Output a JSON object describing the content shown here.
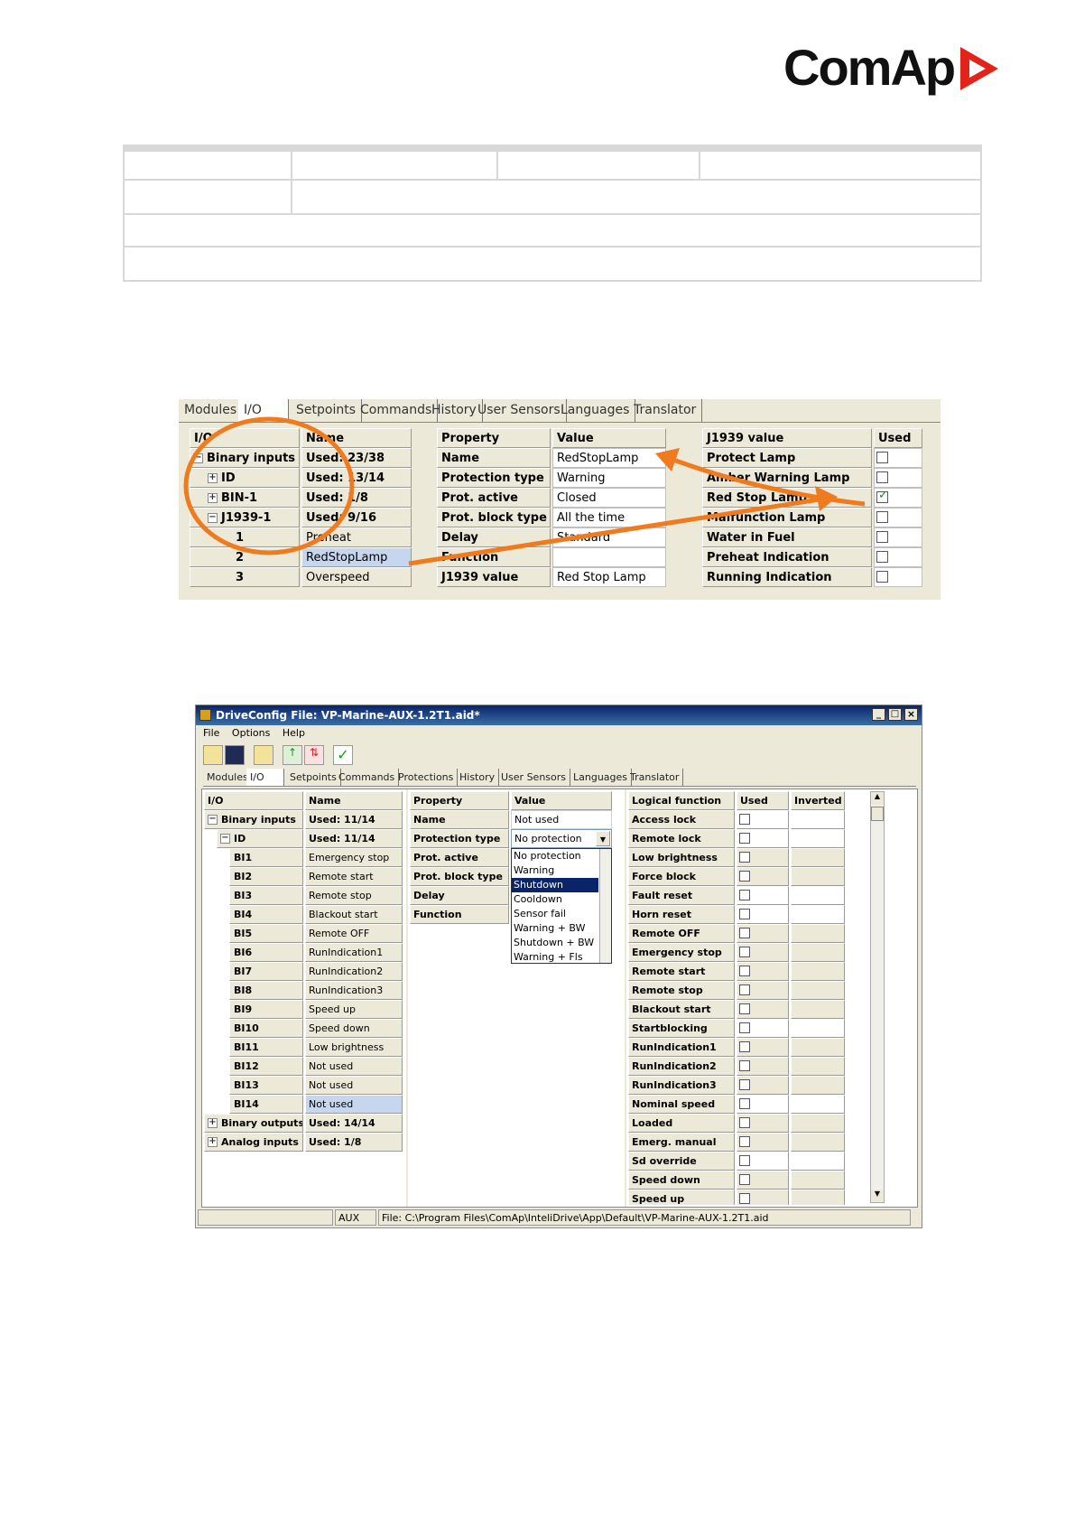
{
  "logo": {
    "text": "ComAp"
  },
  "screenshot1": {
    "tabs": [
      "Modules",
      "I/O",
      "Setpoints",
      "Commands",
      "History",
      "User Sensors",
      "Languages",
      "Translator"
    ],
    "io_header": [
      "I/O",
      "Name"
    ],
    "io_rows": [
      {
        "io": "Binary inputs",
        "name": "Used: 23/38"
      },
      {
        "io": "ID",
        "name": "Used: 13/14"
      },
      {
        "io": "BIN-1",
        "name": "Used: 1/8"
      },
      {
        "io": "J1939-1",
        "name": "Used: 9/16"
      },
      {
        "io": "1",
        "name": "Preheat"
      },
      {
        "io": "2",
        "name": "RedStopLamp"
      },
      {
        "io": "3",
        "name": "Overspeed"
      }
    ],
    "prop_header": [
      "Property",
      "Value"
    ],
    "prop_rows": [
      {
        "p": "Name",
        "v": "RedStopLamp"
      },
      {
        "p": "Protection type",
        "v": "Warning"
      },
      {
        "p": "Prot. active",
        "v": "Closed"
      },
      {
        "p": "Prot. block type",
        "v": "All the time"
      },
      {
        "p": "Delay",
        "v": "Standard"
      },
      {
        "p": "Function",
        "v": ""
      },
      {
        "p": "J1939 value",
        "v": "Red Stop Lamp"
      }
    ],
    "j1939_header": [
      "J1939 value",
      "Used"
    ],
    "j1939_rows": [
      {
        "name": "Protect Lamp",
        "used": false
      },
      {
        "name": "Amber Warning Lamp",
        "used": false
      },
      {
        "name": "Red Stop Lamp",
        "used": true
      },
      {
        "name": "Malfunction Lamp",
        "used": false
      },
      {
        "name": "Water in Fuel",
        "used": false
      },
      {
        "name": "Preheat Indication",
        "used": false
      },
      {
        "name": "Running Indication",
        "used": false
      }
    ],
    "accent": "#f07a1e"
  },
  "screenshot2": {
    "title": "DriveConfig File: VP-Marine-AUX-1.2T1.aid*",
    "menu": [
      "File",
      "Options",
      "Help"
    ],
    "tabs": [
      "Modules",
      "I/O",
      "Setpoints",
      "Commands",
      "Protections",
      "History",
      "User Sensors",
      "Languages",
      "Translator"
    ],
    "io_header": [
      "I/O",
      "Name"
    ],
    "io_rows": [
      {
        "io": "Binary inputs",
        "name": "Used: 11/14"
      },
      {
        "io": "ID",
        "name": "Used: 11/14"
      },
      {
        "io": "BI1",
        "name": "Emergency stop"
      },
      {
        "io": "BI2",
        "name": "Remote start"
      },
      {
        "io": "BI3",
        "name": "Remote stop"
      },
      {
        "io": "BI4",
        "name": "Blackout start"
      },
      {
        "io": "BI5",
        "name": "Remote OFF"
      },
      {
        "io": "BI6",
        "name": "RunIndication1"
      },
      {
        "io": "BI7",
        "name": "RunIndication2"
      },
      {
        "io": "BI8",
        "name": "RunIndication3"
      },
      {
        "io": "BI9",
        "name": "Speed up"
      },
      {
        "io": "BI10",
        "name": "Speed down"
      },
      {
        "io": "BI11",
        "name": "Low brightness"
      },
      {
        "io": "BI12",
        "name": "Not used"
      },
      {
        "io": "BI13",
        "name": "Not used"
      },
      {
        "io": "BI14",
        "name": "Not used"
      },
      {
        "io": "Binary outputs",
        "name": "Used: 14/14"
      },
      {
        "io": "Analog inputs",
        "name": "Used: 1/8"
      }
    ],
    "prop_header": [
      "Property",
      "Value"
    ],
    "prop_rows": [
      {
        "p": "Name",
        "v": "Not used"
      },
      {
        "p": "Protection type",
        "v": "No protection"
      },
      {
        "p": "Prot. active",
        "v": ""
      },
      {
        "p": "Prot. block type",
        "v": ""
      },
      {
        "p": "Delay",
        "v": ""
      },
      {
        "p": "Function",
        "v": ""
      }
    ],
    "dropdown_options": [
      "No protection",
      "Warning",
      "Shutdown",
      "Cooldown",
      "Sensor fail",
      "Warning + BW",
      "Shutdown + BW",
      "Warning + Fls"
    ],
    "dropdown_selected": "Shutdown",
    "logic_header": [
      "Logical function",
      "Used",
      "Inverted"
    ],
    "logic_rows": [
      "Access lock",
      "Remote lock",
      "Low brightness",
      "Force block",
      "Fault reset",
      "Horn reset",
      "Remote OFF",
      "Emergency stop",
      "Remote start",
      "Remote stop",
      "Blackout start",
      "Startblocking",
      "RunIndication1",
      "RunIndication2",
      "RunIndication3",
      "Nominal speed",
      "Loaded",
      "Emerg. manual",
      "Sd override",
      "Speed down",
      "Speed up"
    ],
    "status": {
      "module": "AUX",
      "file": "File: C:\\Program Files\\ComAp\\InteliDrive\\App\\Default\\VP-Marine-AUX-1.2T1.aid"
    }
  }
}
